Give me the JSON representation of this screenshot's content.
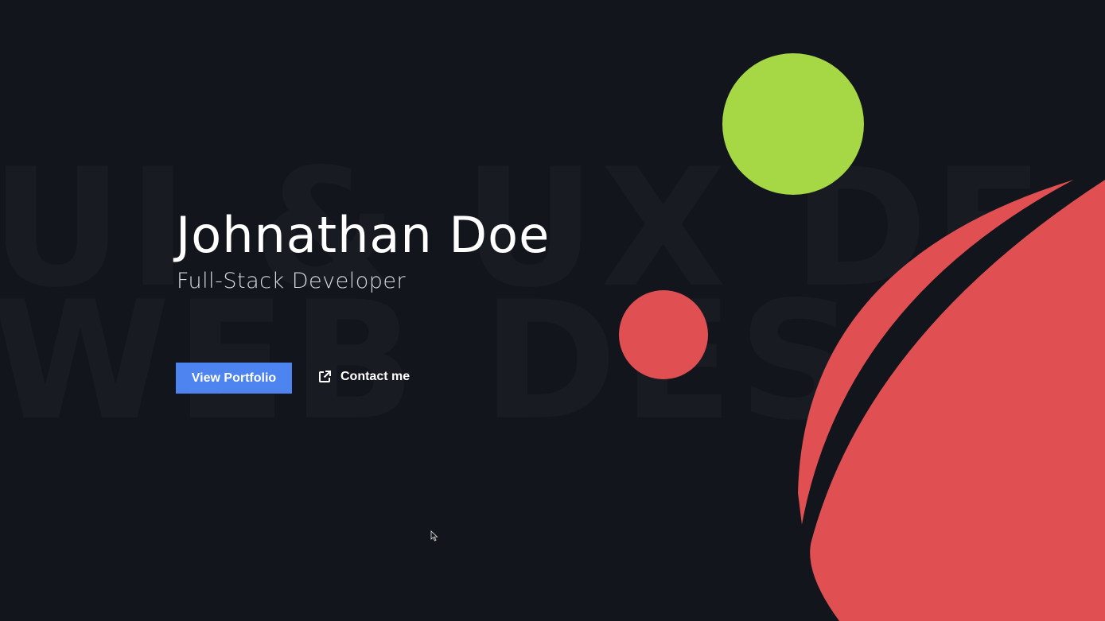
{
  "background_words": {
    "line1": "UI & UX DE",
    "line2": "WEB DES"
  },
  "hero": {
    "name": "Johnathan Doe",
    "role": "Full-Stack Developer"
  },
  "actions": {
    "primary_label": "View Portfolio",
    "secondary_label": "Contact me",
    "secondary_icon": "external-link-icon"
  },
  "colors": {
    "background": "#12151b",
    "accent_blue": "#4d84f0",
    "accent_green": "#a6d845",
    "accent_red": "#e05052"
  }
}
